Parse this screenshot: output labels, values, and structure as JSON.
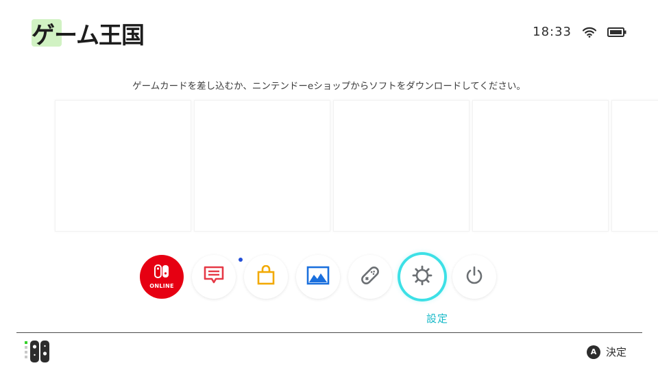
{
  "header": {
    "logo_text": "ゲーム王国",
    "time": "18:33"
  },
  "message": "ゲームカードを差し込むか、ニンテンドーeショップからソフトをダウンロードしてください。",
  "slots": [
    {},
    {},
    {},
    {},
    {}
  ],
  "dock": {
    "items": [
      {
        "name": "nintendo-switch-online",
        "label": "ONLINE"
      },
      {
        "name": "news",
        "has_notification": true
      },
      {
        "name": "eshop"
      },
      {
        "name": "album"
      },
      {
        "name": "controllers"
      },
      {
        "name": "settings",
        "selected": true
      },
      {
        "name": "sleep-mode"
      }
    ],
    "selected_label": "設定"
  },
  "footer": {
    "a_button": "A",
    "action_label": "決定"
  },
  "colors": {
    "accent_cyan": "#3de0e6",
    "label_cyan": "#13b8c7",
    "online_red": "#e60012",
    "news_red": "#e63946",
    "eshop_orange": "#f2a900",
    "album_blue": "#1a6fdd",
    "icon_gray": "#6b6f73",
    "notification_blue": "#2450d8",
    "player_green": "#35d12b"
  }
}
